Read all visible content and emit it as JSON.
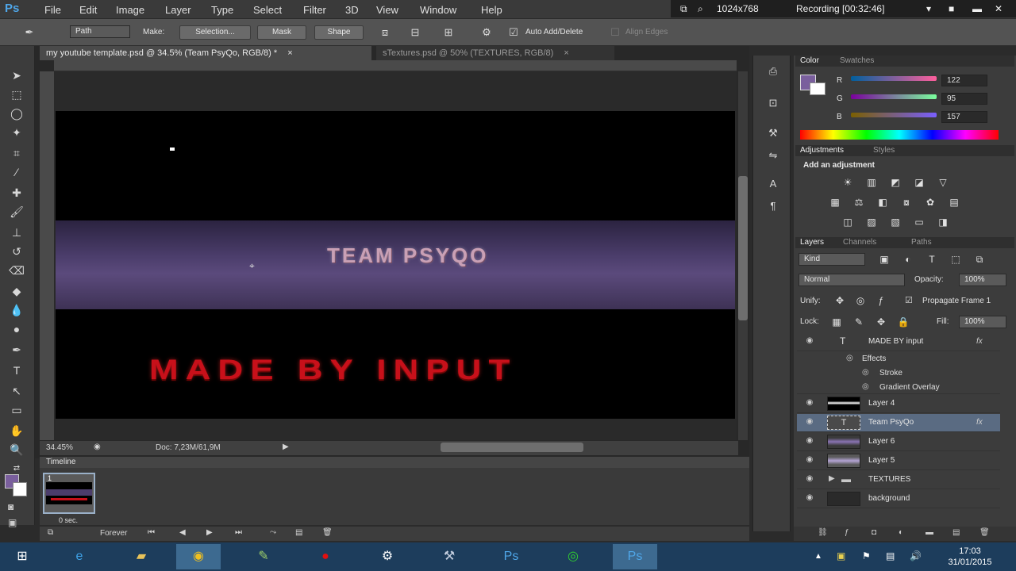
{
  "app": {
    "logo": "Ps"
  },
  "menu": [
    "File",
    "Edit",
    "Image",
    "Layer",
    "Type",
    "Select",
    "Filter",
    "3D",
    "View",
    "Window",
    "Help"
  ],
  "recorder": {
    "size": "1024x768",
    "status": "Recording [00:32:46]"
  },
  "options": {
    "mode": "Path",
    "make_label": "Make:",
    "selection_btn": "Selection...",
    "mask_btn": "Mask",
    "shape_btn": "Shape",
    "auto_add_delete": "Auto Add/Delete",
    "align_edges": "Align Edges"
  },
  "tabs": [
    {
      "label": "my youtube template.psd @ 34.5% (Team PsyQo, RGB/8) *",
      "close": "×"
    },
    {
      "label": "sTextures.psd @ 50% (TEXTURES, RGB/8)",
      "close": "×"
    }
  ],
  "canvas": {
    "team_text": "TEAM PSYQO",
    "made_text": "MADE BY INPUT"
  },
  "status": {
    "zoom": "34.45%",
    "doc": "Doc: 7,23M/61,9M"
  },
  "timeline": {
    "title": "Timeline",
    "frame_number": "1",
    "frame_delay": "0 sec.",
    "loop": "Forever"
  },
  "color_panel": {
    "tabs": [
      "Color",
      "Swatches"
    ],
    "r_label": "R",
    "g_label": "G",
    "b_label": "B",
    "r": "122",
    "g": "95",
    "b": "157",
    "fg_color": "#7a5f9d"
  },
  "adjustments": {
    "tabs": [
      "Adjustments",
      "Styles"
    ],
    "heading": "Add an adjustment"
  },
  "layers_panel": {
    "tabs": [
      "Layers",
      "Channels",
      "Paths"
    ],
    "kind": "Kind",
    "blend_mode": "Normal",
    "opacity_label": "Opacity:",
    "opacity": "100%",
    "unify_label": "Unify:",
    "propagate": "Propagate Frame 1",
    "lock_label": "Lock:",
    "fill_label": "Fill:",
    "fill": "100%",
    "layers": [
      {
        "name": "MADE BY input",
        "fx": "fx"
      },
      {
        "name": "Effects"
      },
      {
        "name": "Stroke"
      },
      {
        "name": "Gradient Overlay"
      },
      {
        "name": "Layer 4"
      },
      {
        "name": "Team PsyQo",
        "fx": "fx"
      },
      {
        "name": "Layer 6"
      },
      {
        "name": "Layer 5"
      },
      {
        "name": "TEXTURES"
      },
      {
        "name": "background"
      }
    ]
  },
  "taskbar": {
    "time": "17:03",
    "date": "31/01/2015"
  }
}
